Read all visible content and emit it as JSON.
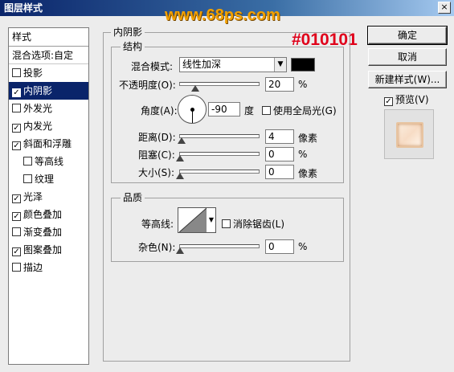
{
  "window": {
    "title": "图层样式",
    "watermark": "www.68ps.com",
    "close_glyph": "×"
  },
  "annotation": "#010101",
  "style_list": {
    "header": "样式",
    "blend_options": "混合选项:自定",
    "items": [
      {
        "label": "投影",
        "checked": false,
        "selected": false,
        "indent": false
      },
      {
        "label": "内阴影",
        "checked": true,
        "selected": true,
        "indent": false
      },
      {
        "label": "外发光",
        "checked": false,
        "selected": false,
        "indent": false
      },
      {
        "label": "内发光",
        "checked": true,
        "selected": false,
        "indent": false
      },
      {
        "label": "斜面和浮雕",
        "checked": true,
        "selected": false,
        "indent": false
      },
      {
        "label": "等高线",
        "checked": false,
        "selected": false,
        "indent": true
      },
      {
        "label": "纹理",
        "checked": false,
        "selected": false,
        "indent": true
      },
      {
        "label": "光泽",
        "checked": true,
        "selected": false,
        "indent": false
      },
      {
        "label": "颜色叠加",
        "checked": true,
        "selected": false,
        "indent": false
      },
      {
        "label": "渐变叠加",
        "checked": false,
        "selected": false,
        "indent": false
      },
      {
        "label": "图案叠加",
        "checked": true,
        "selected": false,
        "indent": false
      },
      {
        "label": "描边",
        "checked": false,
        "selected": false,
        "indent": false
      }
    ]
  },
  "inner_shadow": {
    "title": "内阴影",
    "structure": {
      "title": "结构",
      "blend_mode_label": "混合模式:",
      "blend_mode_value": "线性加深",
      "color": "#000000",
      "opacity_label": "不透明度(O):",
      "opacity_value": "20",
      "opacity_fraction": 0.2,
      "opacity_unit": "%",
      "angle_label": "角度(A):",
      "angle_value": "-90",
      "angle_unit": "度",
      "global_light_label": "使用全局光(G)",
      "global_light_checked": false,
      "distance_label": "距离(D):",
      "distance_value": "4",
      "distance_unit": "像素",
      "choke_label": "阻塞(C):",
      "choke_value": "0",
      "choke_unit": "%",
      "size_label": "大小(S):",
      "size_value": "0",
      "size_unit": "像素"
    },
    "quality": {
      "title": "品质",
      "contour_label": "等高线:",
      "anti_alias_label": "消除锯齿(L)",
      "anti_alias_checked": false,
      "noise_label": "杂色(N):",
      "noise_value": "0",
      "noise_unit": "%"
    }
  },
  "buttons": {
    "ok": "确定",
    "cancel": "取消",
    "new_style": "新建样式(W)...",
    "preview_label": "预览(V)",
    "preview_checked": true
  }
}
